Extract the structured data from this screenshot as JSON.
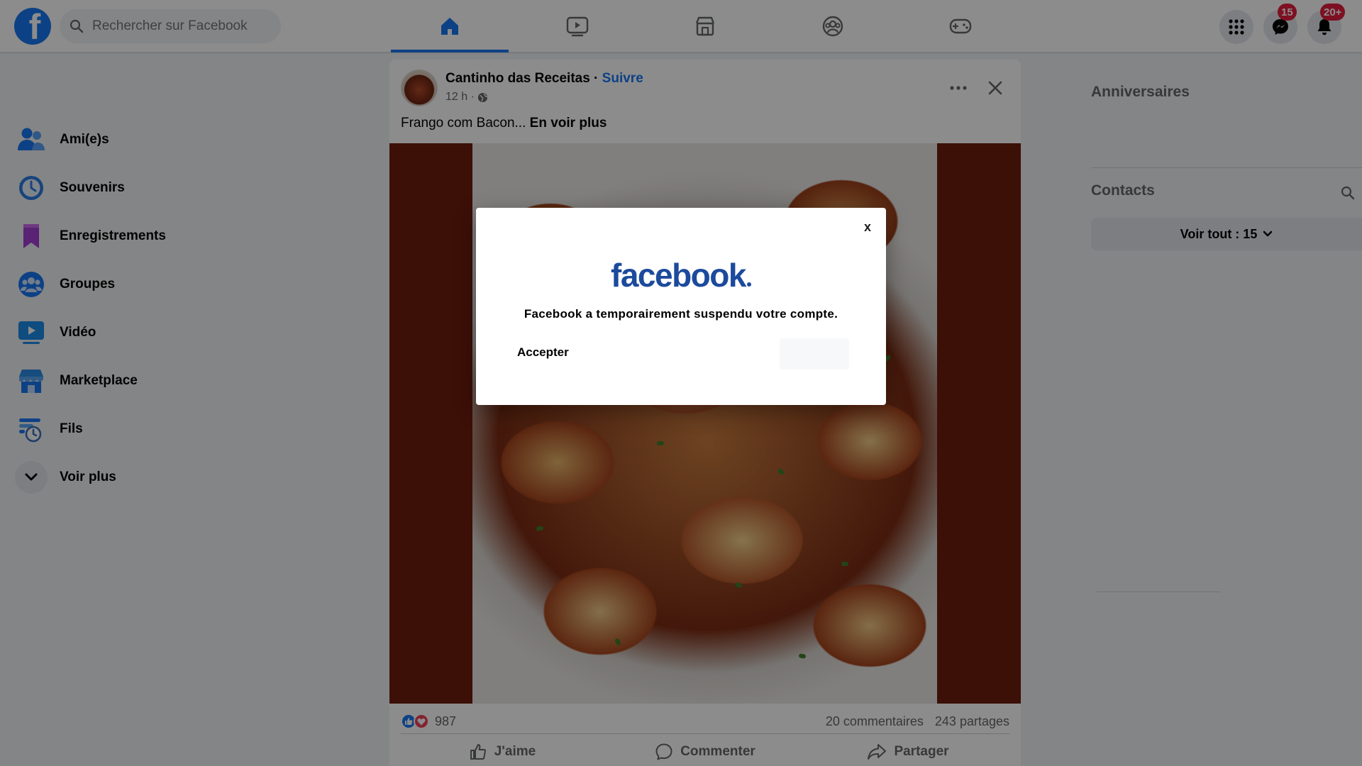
{
  "topbar": {
    "logo_letter": "f",
    "search_placeholder": "Rechercher sur Facebook",
    "tabs": [
      {
        "icon": "home-icon",
        "active": true
      },
      {
        "icon": "video-icon",
        "active": false
      },
      {
        "icon": "marketplace-icon",
        "active": false
      },
      {
        "icon": "groups-icon",
        "active": false
      },
      {
        "icon": "gaming-icon",
        "active": false
      }
    ],
    "messenger_badge": "15",
    "notifications_badge": "20+"
  },
  "sidebar": {
    "items": [
      {
        "label": "Ami(e)s",
        "icon": "friends-icon"
      },
      {
        "label": "Souvenirs",
        "icon": "memories-icon"
      },
      {
        "label": "Enregistrements",
        "icon": "saved-icon"
      },
      {
        "label": "Groupes",
        "icon": "groups-icon"
      },
      {
        "label": "Vidéo",
        "icon": "video-icon"
      },
      {
        "label": "Marketplace",
        "icon": "marketplace-icon"
      },
      {
        "label": "Fils",
        "icon": "feeds-icon"
      },
      {
        "label": "Voir plus",
        "icon": "chevron-down-icon"
      }
    ]
  },
  "post": {
    "author": "Cantinho das Receitas",
    "separator": " · ",
    "follow_label": "Suivre",
    "time": "12 h ·",
    "text": "Frango com Bacon... ",
    "see_more": "En voir plus",
    "reaction_count": "987",
    "comments": "20 commentaires",
    "shares": "243 partages",
    "actions": {
      "like": "J'aime",
      "comment": "Commenter",
      "share": "Partager"
    }
  },
  "right": {
    "birthdays_title": "Anniversaires",
    "contacts_title": "Contacts",
    "see_all": "Voir tout : 15"
  },
  "modal": {
    "close_label": "x",
    "logo_text": "facebook",
    "message": "Facebook a temporairement suspendu votre compte.",
    "accept_label": "Accepter"
  },
  "colors": {
    "brand": "#1877f2",
    "badge": "#e41e3f",
    "modal_logo": "#1c4a9c"
  }
}
